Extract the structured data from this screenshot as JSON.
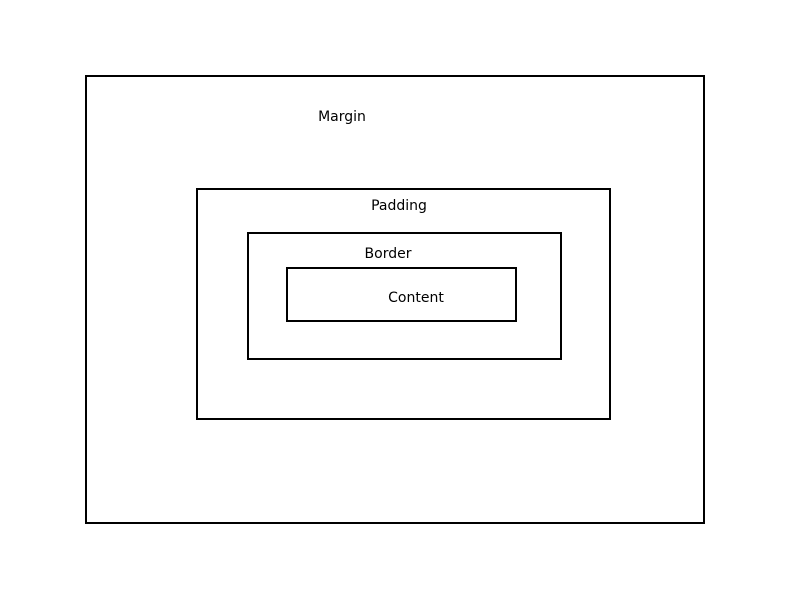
{
  "diagram": {
    "layers": {
      "margin": {
        "label": "Margin"
      },
      "padding": {
        "label": "Padding"
      },
      "border": {
        "label": "Border"
      },
      "content": {
        "label": "Content"
      }
    },
    "colors": {
      "stroke": "#000000",
      "background": "#ffffff",
      "text": "#000000"
    }
  }
}
